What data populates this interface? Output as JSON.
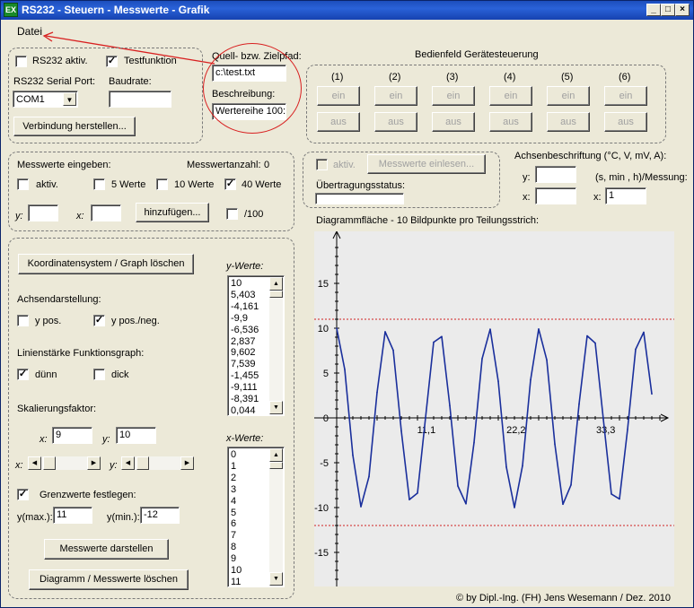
{
  "window": {
    "title": "RS232 - Steuern - Messwerte - Grafik",
    "icon": "app-icon",
    "controls": [
      "_",
      "□",
      "×"
    ]
  },
  "menu": {
    "file": "Datei"
  },
  "rs232": {
    "active_label": "RS232 aktiv.",
    "active_checked": false,
    "test_label": "Testfunktion",
    "test_checked": true,
    "port_label": "RS232 Serial Port:",
    "port_value": "COM1",
    "baud_label": "Baudrate:",
    "baud_value": "",
    "connect_button": "Verbindung herstellen..."
  },
  "file": {
    "path_label": "Quell- bzw. Zielpfad:",
    "path_value": "c:\\test.txt",
    "desc_label": "Beschreibung:",
    "desc_value": "Wertereihe 100:"
  },
  "device": {
    "title": "Bedienfeld Gerätesteuerung",
    "channels": [
      "(1)",
      "(2)",
      "(3)",
      "(4)",
      "(5)",
      "(6)"
    ],
    "on_label": "ein",
    "off_label": "aus"
  },
  "input": {
    "title": "Messwerte eingeben:",
    "count_label": "Messwertanzahl:",
    "count_value": "0",
    "active_label": "aktiv.",
    "five_label": "5 Werte",
    "ten_label": "10 Werte",
    "forty_label": "40 Werte",
    "forty_checked": true,
    "y_label": "y:",
    "x_label": "x:",
    "y_value": "",
    "x_value": "",
    "add_button": "hinzufügen...",
    "div_label": "/100"
  },
  "transfer": {
    "active_label": "aktiv.",
    "read_button": "Messwerte einlesen...",
    "status_label": "Übertragungsstatus:",
    "status_value": ""
  },
  "axis": {
    "title": "Achsenbeschriftung (°C, V, mV, A):",
    "y_label": "y:",
    "y_value": "",
    "unit_label": "(s, min , h)/Messung:",
    "x_label": "x:",
    "x_value": "",
    "x2_label": "x:",
    "x2_value": "1"
  },
  "graph": {
    "clear_button": "Koordinatensystem / Graph löschen",
    "axis_display_label": "Achsendarstellung:",
    "y_pos_label": "y  pos.",
    "y_pos_checked": false,
    "y_posneg_label": "y  pos./neg.",
    "y_posneg_checked": true,
    "line_width_label": "Linienstärke Funktionsgraph:",
    "thin_label": "dünn",
    "thin_checked": true,
    "thick_label": "dick",
    "thick_checked": false,
    "scale_label": "Skalierungsfaktor:",
    "scale_x_label": "x:",
    "scale_x_value": "9",
    "scale_y_label": "y:",
    "scale_y_value": "10",
    "scroll_x_label": "x:",
    "scroll_y_label": "y:",
    "limits_label": "Grenzwerte festlegen:",
    "limits_checked": true,
    "ymax_label": "y(max.):",
    "ymax_value": "11",
    "ymin_label": "y(min.):",
    "ymin_value": "-12",
    "show_button": "Messwerte darstellen",
    "delete_button": "Diagramm / Messwerte löschen"
  },
  "lists": {
    "y_title": "y-Werte:",
    "y_values": [
      "10",
      "5,403",
      "-4,161",
      "-9,9",
      "-6,536",
      "2,837",
      "9,602",
      "7,539",
      "-1,455",
      "-9,111",
      "-8,391",
      "0,044"
    ],
    "x_title": "x-Werte:",
    "x_values": [
      "0",
      "1",
      "2",
      "3",
      "4",
      "5",
      "6",
      "7",
      "8",
      "9",
      "10",
      "11"
    ]
  },
  "diagram": {
    "title": "Diagrammfläche - 10 Bildpunkte pro Teilungsstrich:"
  },
  "chart_data": {
    "type": "line",
    "title": "Diagrammfläche - 10 Bildpunkte pro Teilungsstrich:",
    "xlabel": "",
    "ylabel": "",
    "x_ticks": [
      "11,1",
      "22,2",
      "33,3"
    ],
    "x_tick_values": [
      11.1,
      22.2,
      33.3
    ],
    "y_ticks": [
      "15",
      "10",
      "5",
      "0",
      "-5",
      "-10",
      "-15"
    ],
    "y_tick_values": [
      15,
      10,
      5,
      0,
      -5,
      -10,
      -15
    ],
    "xlim": [
      0,
      40
    ],
    "ylim": [
      -20,
      20
    ],
    "grid": false,
    "limit_lines": [
      11,
      -12
    ],
    "limit_color": "#d02020",
    "line_color": "#1a2f9c",
    "series": [
      {
        "x": [
          0,
          1,
          2,
          3,
          4,
          5,
          6,
          7,
          8,
          9,
          10,
          11,
          12,
          13,
          14,
          15,
          16,
          17,
          18,
          19,
          20,
          21,
          22,
          23,
          24,
          25,
          26,
          27,
          28,
          29,
          30,
          31,
          32,
          33,
          34,
          35,
          36,
          37,
          38,
          39
        ],
        "values": [
          10,
          5.403,
          -4.161,
          -9.9,
          -6.536,
          2.837,
          9.602,
          7.539,
          -1.455,
          -9.111,
          -8.391,
          0.044,
          8.439,
          9.074,
          1.367,
          -7.597,
          -9.577,
          -2.752,
          6.603,
          9.887,
          4.081,
          -5.477,
          -9.999,
          -5.328,
          4.242,
          9.912,
          6.469,
          -2.92,
          -9.626,
          -7.481,
          1.543,
          9.147,
          8.342,
          -0.133,
          -8.486,
          -9.037,
          -1.279,
          7.654,
          9.551,
          2.666
        ]
      }
    ]
  },
  "footer": "© by Dipl.-Ing. (FH) Jens Wesemann / Dez. 2010",
  "colors": {
    "annotation": "#d82020",
    "title_bar": "#1c4ebd",
    "panel": "#ece9d8"
  }
}
